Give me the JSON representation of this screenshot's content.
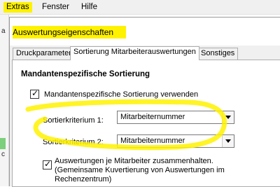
{
  "menubar": {
    "items": [
      "Extras",
      "Fenster",
      "Hilfe"
    ]
  },
  "background_app": {
    "fragments": [
      "a",
      "c"
    ]
  },
  "dialog": {
    "title": "Auswertungseigenschaften",
    "tabs": [
      {
        "label": "Druckparameter",
        "active": false
      },
      {
        "label": "Sortierung Mitarbeiterauswertungen",
        "active": true
      },
      {
        "label": "Sonstiges",
        "active": false
      }
    ],
    "group_title": "Mandantenspezifische Sortierung",
    "use_checkbox_label": "Mandantenspezifische Sortierung verwenden",
    "use_checkbox_checked": true,
    "criterion1": {
      "label": "Sortierkriterium 1:",
      "value": "Mitarbeiternummer"
    },
    "criterion2": {
      "label": "Sortierkriterium 2:",
      "value": "Mitarbeiternummer"
    },
    "keep_together_checked": true,
    "keep_together_line1": "Auswertungen je Mitarbeiter zusammenhalten.",
    "keep_together_line2": "(Gemeinsame Kuvertierung von Auswertungen im Rechenzentrum)"
  },
  "colors": {
    "highlighter": "#fff200",
    "window_bg": "#f0f0f0",
    "panel_bg": "#ffffff"
  }
}
